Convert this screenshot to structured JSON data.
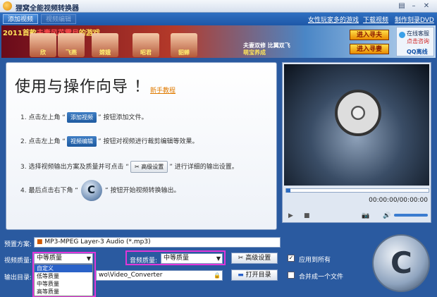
{
  "window": {
    "title": "狸窝全能视频转换器"
  },
  "tabs": [
    {
      "label": "添加视频"
    },
    {
      "label": "视频编辑"
    }
  ],
  "toplinks": [
    {
      "label": "女性玩家多的游戏"
    },
    {
      "label": "下载视频"
    },
    {
      "label": "制作刻录DVD"
    }
  ],
  "banner": {
    "promo_prefix": "2011首款",
    "promo_highlight": "夫妻风花雪月",
    "promo_suffix": "的游戏",
    "portraits": [
      "欣",
      "飞燕",
      "嫦娥",
      "昭君",
      "貂蝉"
    ],
    "mid1": "夫妻双修 比翼双飞",
    "mid2": "萌宝养成",
    "btn1": "进入寻夫",
    "btn2": "进入寻妻",
    "service1": "在线客服",
    "service2": "点击咨询",
    "service3": "QQ离线"
  },
  "guide": {
    "title": "使用与操作向导 ！",
    "tutorial_link": "新手教程",
    "step1_pre": "1. 点击左上角 “",
    "step1_chip": "添加视频",
    "step1_post": "” 按钮添加文件。",
    "step2_pre": "2. 点击左上角 “",
    "step2_chip": "视频编辑",
    "step2_post": "” 按钮对视频进行裁剪编辑等效果。",
    "step3_pre": "3. 选择视频输出方案及质量并可点击 “",
    "step3_chip": "高级设置",
    "step3_post": "” 进行详细的输出设置。",
    "step4_pre": "4. 最后点击右下角 “",
    "step4_post": "” 按钮开始视频转换输出。"
  },
  "player": {
    "time": "00:00:00/00:00:00",
    "progress": 0
  },
  "bottom": {
    "preset_label": "预置方案:",
    "preset_value": "MP3-MPEG Layer-3 Audio (*.mp3)",
    "vq_label": "视频质量:",
    "vq_value": "中等质量",
    "aq_label": "音频质量:",
    "aq_value": "中等质量",
    "adv_btn": "高级设置",
    "apply_all": "应用到所有",
    "out_label": "输出目录:",
    "out_value": "wo\\Video_Converter",
    "open_btn": "打开目录",
    "merge": "合并成一个文件",
    "vq_options": [
      "自定义",
      "低等质量",
      "中等质量",
      "高等质量"
    ]
  },
  "colors": {
    "accent": "#2a62c8",
    "highlight": "#e236d8"
  }
}
